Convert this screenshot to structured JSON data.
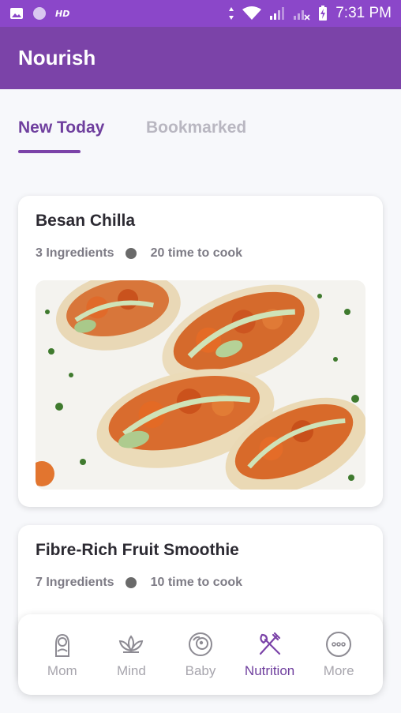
{
  "status_bar": {
    "network_badge": "HD",
    "time": "7:31 PM",
    "icons": [
      "image-icon",
      "circle-icon",
      "data-arrows-icon",
      "wifi-icon",
      "signal-icon",
      "signal-off-icon",
      "battery-icon"
    ]
  },
  "app": {
    "title": "Nourish"
  },
  "tabs": [
    {
      "label": "New Today",
      "active": true
    },
    {
      "label": "Bookmarked",
      "active": false
    }
  ],
  "recipes": [
    {
      "title": "Besan Chilla",
      "ingredients": "3 Ingredients",
      "cook_time": "20 time to cook",
      "image": "tacos-photo"
    },
    {
      "title": "Fibre-Rich Fruit Smoothie",
      "ingredients": "7 Ingredients",
      "cook_time": "10 time to cook"
    }
  ],
  "bottom_nav": {
    "items": [
      {
        "label": "Mom",
        "icon": "mom-icon",
        "active": false
      },
      {
        "label": "Mind",
        "icon": "lotus-icon",
        "active": false
      },
      {
        "label": "Baby",
        "icon": "baby-icon",
        "active": false
      },
      {
        "label": "Nutrition",
        "icon": "fork-knife-icon",
        "active": true
      },
      {
        "label": "More",
        "icon": "more-icon",
        "active": false
      }
    ]
  },
  "colors": {
    "status_bar": "#8b47c9",
    "app_bar": "#7b43a8",
    "accent": "#6f3f9e",
    "inactive": "#a7a5ad"
  }
}
